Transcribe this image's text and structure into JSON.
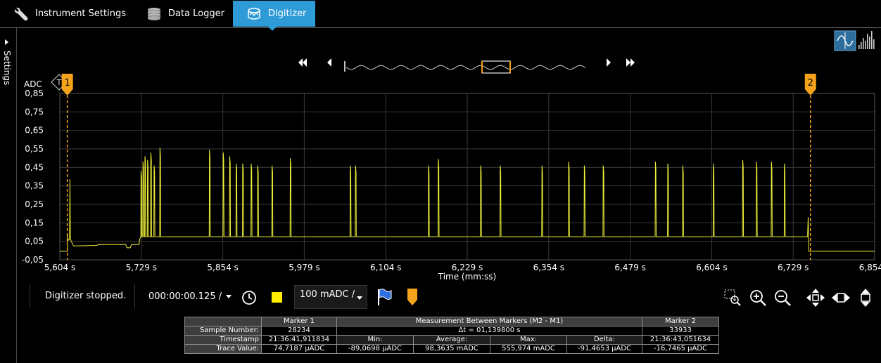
{
  "tabs": [
    {
      "label": "Instrument Settings",
      "icon": "wrench-icon"
    },
    {
      "label": "Data Logger",
      "icon": "database-icon"
    },
    {
      "label": "Digitizer",
      "icon": "digitizer-icon",
      "active": true
    }
  ],
  "sidebar": {
    "label": "Settings"
  },
  "colors": {
    "accent": "#2e9bd6",
    "trace": "#f0f03a",
    "marker": "#f5a31a",
    "grid": "#3a3a3a"
  },
  "chart_data": {
    "type": "line",
    "ylabel": "ADC",
    "xlabel": "Time (mm:ss)",
    "ylim": [
      -0.05,
      0.85
    ],
    "xlim": [
      5.604,
      6.854
    ],
    "yticks": [
      "0,85",
      "0,75",
      "0,65",
      "0,55",
      "0,45",
      "0,35",
      "0,25",
      "0,15",
      "0,05",
      "-0,05"
    ],
    "ytick_values": [
      0.85,
      0.75,
      0.65,
      0.55,
      0.45,
      0.35,
      0.25,
      0.15,
      0.05,
      -0.05
    ],
    "xticks": [
      "5,604 s",
      "5,729 s",
      "5,854 s",
      "5,979 s",
      "6,104 s",
      "6,229 s",
      "6,354 s",
      "6,479 s",
      "6,604 s",
      "6,729 s",
      "6,854 s"
    ],
    "xtick_values": [
      5.604,
      5.729,
      5.854,
      5.979,
      6.104,
      6.229,
      6.354,
      6.479,
      6.604,
      6.729,
      6.854
    ],
    "grid": true,
    "trigger_label": "T",
    "markers": [
      {
        "label": "1",
        "x": 5.6155
      },
      {
        "label": "2",
        "x": 6.7555
      }
    ],
    "series": [
      {
        "baseline": 0.075,
        "idle_level": -0.004,
        "step_level": 0.033,
        "pulses": [
          {
            "x": 5.6195,
            "y": 0.385
          },
          {
            "x": 5.729,
            "y": 0.43
          },
          {
            "x": 5.732,
            "y": 0.48
          },
          {
            "x": 5.735,
            "y": 0.51
          },
          {
            "x": 5.739,
            "y": 0.49
          },
          {
            "x": 5.744,
            "y": 0.53
          },
          {
            "x": 5.749,
            "y": 0.46
          },
          {
            "x": 5.758,
            "y": 0.555
          },
          {
            "x": 5.834,
            "y": 0.545
          },
          {
            "x": 5.855,
            "y": 0.53
          },
          {
            "x": 5.865,
            "y": 0.51
          },
          {
            "x": 5.875,
            "y": 0.47
          },
          {
            "x": 5.885,
            "y": 0.47
          },
          {
            "x": 5.898,
            "y": 0.47
          },
          {
            "x": 5.908,
            "y": 0.46
          },
          {
            "x": 5.93,
            "y": 0.46
          },
          {
            "x": 5.958,
            "y": 0.5
          },
          {
            "x": 6.05,
            "y": 0.46
          },
          {
            "x": 6.058,
            "y": 0.46
          },
          {
            "x": 6.17,
            "y": 0.46
          },
          {
            "x": 6.185,
            "y": 0.495
          },
          {
            "x": 6.25,
            "y": 0.46
          },
          {
            "x": 6.28,
            "y": 0.46
          },
          {
            "x": 6.344,
            "y": 0.46
          },
          {
            "x": 6.385,
            "y": 0.48
          },
          {
            "x": 6.409,
            "y": 0.46
          },
          {
            "x": 6.438,
            "y": 0.46
          },
          {
            "x": 6.518,
            "y": 0.48
          },
          {
            "x": 6.537,
            "y": 0.47
          },
          {
            "x": 6.56,
            "y": 0.46
          },
          {
            "x": 6.607,
            "y": 0.47
          },
          {
            "x": 6.652,
            "y": 0.49
          },
          {
            "x": 6.673,
            "y": 0.48
          },
          {
            "x": 6.696,
            "y": 0.48
          },
          {
            "x": 6.716,
            "y": 0.47
          },
          {
            "x": 6.752,
            "y": 0.18
          }
        ]
      }
    ]
  },
  "nav": {
    "first_icon": "skip-back-icon",
    "prev_icon": "step-back-icon",
    "next_icon": "step-forward-icon",
    "last_icon": "skip-forward-icon"
  },
  "controls": {
    "status": "Digitizer stopped.",
    "duration": "000:00:00.125 /",
    "range": "100 mADC /"
  },
  "measurement": {
    "marker1_header": "Marker 1",
    "between_header": "Measurement Between Markers (M2 - M1)",
    "marker2_header": "Marker 2",
    "sample_label": "Sample Number:",
    "timestamp_label": "Timestamp",
    "trace_label": "Trace Value:",
    "m1_sample": "28234",
    "delta_t": "Δt = 01,139800 s",
    "m2_sample": "33933",
    "m1_timestamp": "21:36:41,911834",
    "min_label": "Min:",
    "avg_label": "Average:",
    "max_label": "Max:",
    "delta_label": "Delta:",
    "m2_timestamp": "21:36:43,051634",
    "m1_value": "74,7187 µADC",
    "min_value": "-89,0698 µADC",
    "avg_value": "98,3635 mADC",
    "max_value": "555,974 mADC",
    "delta_value": "-91,4653 µADC",
    "m2_value": "-16,7465 µADC"
  }
}
